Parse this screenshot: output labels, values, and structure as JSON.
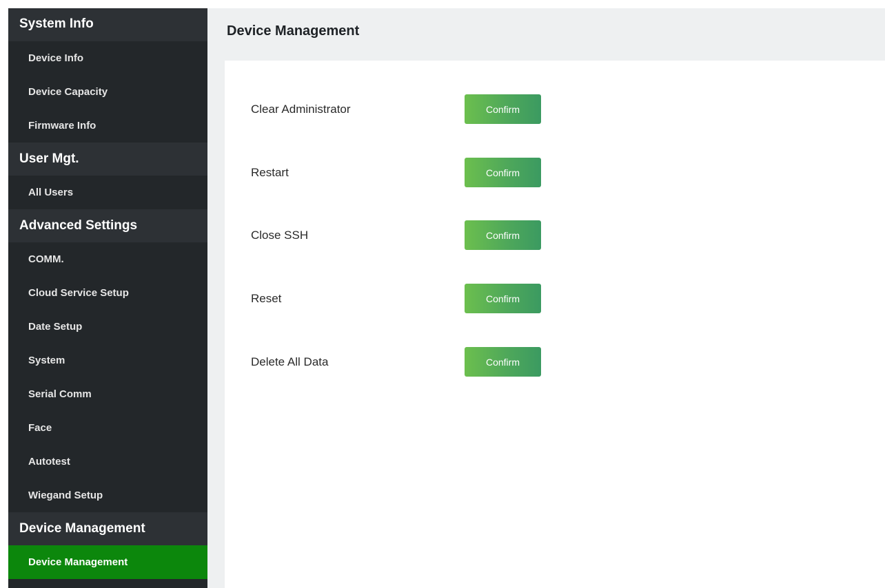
{
  "sidebar": {
    "groups": [
      {
        "title": "System Info",
        "items": [
          {
            "label": "Device Info"
          },
          {
            "label": "Device Capacity"
          },
          {
            "label": "Firmware Info"
          }
        ]
      },
      {
        "title": "User Mgt.",
        "items": [
          {
            "label": "All Users"
          }
        ]
      },
      {
        "title": "Advanced Settings",
        "items": [
          {
            "label": "COMM."
          },
          {
            "label": "Cloud Service Setup"
          },
          {
            "label": "Date Setup"
          },
          {
            "label": "System"
          },
          {
            "label": "Serial Comm"
          },
          {
            "label": "Face"
          },
          {
            "label": "Autotest"
          },
          {
            "label": "Wiegand Setup"
          }
        ]
      },
      {
        "title": "Device Management",
        "items": [
          {
            "label": "Device Management",
            "active": true
          }
        ]
      }
    ]
  },
  "main": {
    "title": "Device Management",
    "actions": [
      {
        "label": "Clear Administrator",
        "button": "Confirm"
      },
      {
        "label": "Restart",
        "button": "Confirm"
      },
      {
        "label": "Close SSH",
        "button": "Confirm"
      },
      {
        "label": "Reset",
        "button": "Confirm"
      },
      {
        "label": "Delete All Data",
        "button": "Confirm"
      }
    ]
  },
  "colors": {
    "sidebar_bg": "#23272a",
    "sidebar_header_bg": "#2d3135",
    "active_item_bg": "#0c870c",
    "button_green": "#4fa85a",
    "content_bg": "#eef0f1"
  }
}
